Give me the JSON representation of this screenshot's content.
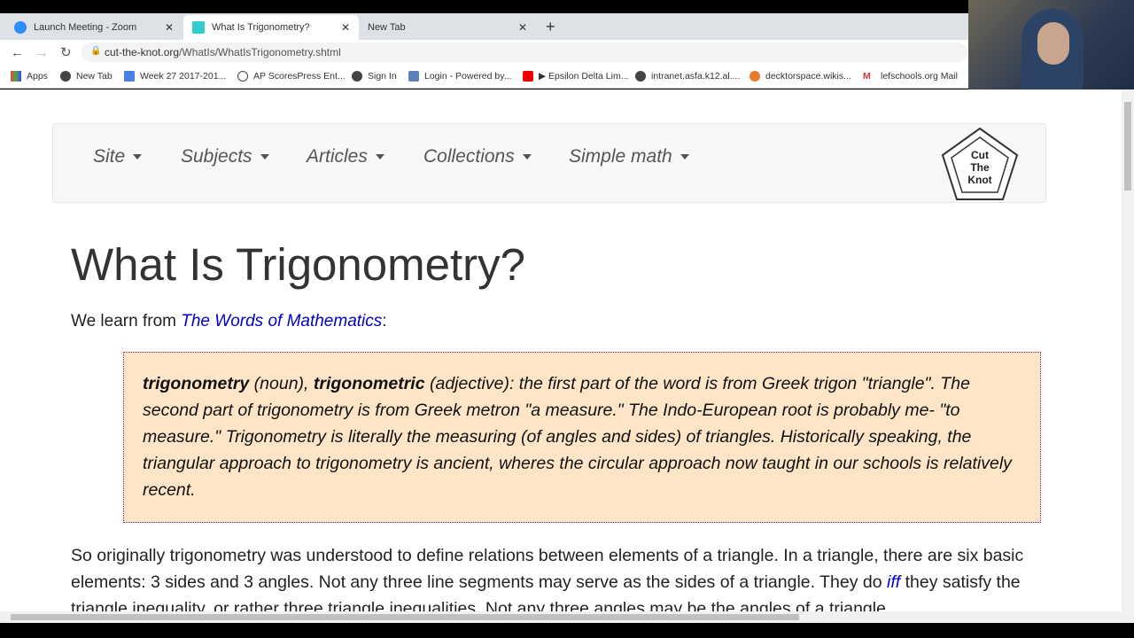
{
  "browser": {
    "tabs": [
      {
        "title": "Launch Meeting - Zoom",
        "icon": "zoom-icon"
      },
      {
        "title": "What Is Trigonometry?",
        "icon": "cut-the-knot-icon",
        "active": true
      },
      {
        "title": "New Tab"
      }
    ],
    "url_host": "cut-the-knot.org",
    "url_path": "/WhatIs/WhatIsTrigonometry.shtml",
    "bookmarks": [
      "Apps",
      "New Tab",
      "Week 27 2017-201...",
      "AP ScoresPress Ent...",
      "Sign In",
      "Login - Powered by...",
      "▶ Epsilon Delta Lim...",
      "intranet.asfa.k12.al....",
      "decktorspace.wikis...",
      "lefschools.org Mail"
    ]
  },
  "nav": {
    "menus": [
      "Site",
      "Subjects",
      "Articles",
      "Collections",
      "Simple math"
    ],
    "logo_text": [
      "Cut",
      "The",
      "Knot"
    ]
  },
  "page": {
    "title": "What Is Trigonometry?",
    "intro_prefix": "We learn from ",
    "intro_link": "The Words of Mathematics",
    "intro_suffix": ":",
    "quote": {
      "term1": "trigonometry",
      "pos1": " (noun), ",
      "term2": "trigonometric",
      "rest": " (adjective): the first part of the word is from Greek trigon \"triangle\". The second part of trigonometry is from Greek metron \"a measure.\" The Indo-European root is probably me- \"to measure.\" Trigonometry is literally the measuring (of angles and sides) of triangles. Historically speaking, the triangular approach to trigonometry is ancient, wheres the circular approach now taught in our schools is relatively recent."
    },
    "para_a": "So originally trigonometry was understood to define relations between elements of a triangle. In a triangle, there are six basic elements: 3 sides and 3 angles. Not any three line segments may serve as the sides of a triangle. They do ",
    "para_link": "iff",
    "para_b": " they satisfy the triangle inequality, or rather three triangle inequalities. Not any three angles may be the angles of a triangle."
  }
}
